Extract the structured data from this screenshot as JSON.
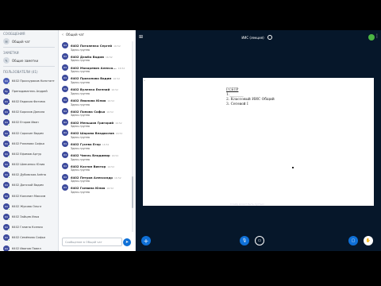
{
  "sidebar": {
    "messages_title": "СООБЩЕНИЯ",
    "public_chat_label": "Общий чат",
    "notes_title": "ЗАМЕТКИ",
    "shared_notes_label": "Общие заметки",
    "users_title": "ПОЛЬЗОВАТЕЛИ (41)",
    "users": [
      {
        "initials": "64",
        "name": "6402 Проскуряков Константин (Вы)"
      },
      {
        "initials": "Пр",
        "name": "Преподаватель Андрей"
      },
      {
        "initials": "64",
        "name": "6402 Евдокия Фатима"
      },
      {
        "initials": "64",
        "name": "6402 Борисов Данила"
      },
      {
        "initials": "64",
        "name": "6402 Егоров Иван"
      },
      {
        "initials": "64",
        "name": "6402 Сорокин Вадим"
      },
      {
        "initials": "64",
        "name": "6402 Рязанова Софья"
      },
      {
        "initials": "64",
        "name": "6402 Ефимов Артур"
      },
      {
        "initials": "64",
        "name": "6402 Шевченко Юлия"
      },
      {
        "initials": "64",
        "name": "6402 Дубовская Алёна"
      },
      {
        "initials": "64",
        "name": "6402 Донской Вадим"
      },
      {
        "initials": "64",
        "name": "6402 Калинин Максим"
      },
      {
        "initials": "64",
        "name": "6402 Жукова Ольга"
      },
      {
        "initials": "64",
        "name": "6402 Зайцев Илья"
      },
      {
        "initials": "64",
        "name": "6402 Ганина Ксения"
      },
      {
        "initials": "64",
        "name": "6402 Семёнова Софья"
      },
      {
        "initials": "64",
        "name": "6402 Иванов Павел"
      }
    ]
  },
  "chat": {
    "title": "Общий чат",
    "messages": [
      {
        "initials": "64",
        "name": "6402 Потапенко Сергей",
        "time": "16:52",
        "text": "Здесь группа"
      },
      {
        "initials": "64",
        "name": "6402 Дзюба Вадим",
        "time": "16:52",
        "text": "Здесь группа"
      },
      {
        "initials": "64",
        "name": "6402 Макаревич Алекса...",
        "time": "16:52",
        "text": "Здесь группа"
      },
      {
        "initials": "64",
        "name": "6402 Прокопова Вадим",
        "time": "16:52",
        "text": "Здесь группа"
      },
      {
        "initials": "64",
        "name": "6402 Вуленко Евгений",
        "time": "16:52",
        "text": "Здесь группа"
      },
      {
        "initials": "64",
        "name": "6402 Яманова Юлия",
        "time": "16:52",
        "text": "Здесь группа"
      },
      {
        "initials": "64",
        "name": "6402 Попова Софья",
        "time": "16:52",
        "text": "Здесь группа"
      },
      {
        "initials": "64",
        "name": "6402 Меньшов Григорий",
        "time": "16:52",
        "text": "Здесь группа"
      },
      {
        "initials": "64",
        "name": "6402 Шарова Владислав",
        "time": "16:52",
        "text": "Здесь группа"
      },
      {
        "initials": "64",
        "name": "6402 Гусева Егор",
        "time": "16:52",
        "text": "Здесь группа"
      },
      {
        "initials": "64",
        "name": "6402 Чмель Владимир",
        "time": "16:52",
        "text": "Здесь группа"
      },
      {
        "initials": "64",
        "name": "6402 Костин Виктор",
        "time": "16:52",
        "text": "Здесь группа"
      },
      {
        "initials": "64",
        "name": "6402 Петров Александр",
        "time": "16:52",
        "text": "Здесь группа"
      },
      {
        "initials": "64",
        "name": "6402 Гаевина Юлия",
        "time": "16:52",
        "text": "Здесь группа"
      }
    ],
    "composer_placeholder": "Сообщение в Общий чат"
  },
  "presentation": {
    "title": "ИИС (лекция)",
    "slide_lines": [
      "ГСБТР",
      "1.________",
      "2. Классовый ИИС Общий",
      "3. Сетевой I"
    ],
    "watermark": "Слайд может быть пустым"
  },
  "icons": {
    "messages": "chat-icon",
    "notes": "note-icon",
    "record": "record-icon",
    "plus": "plus-icon",
    "mic": "mic-icon",
    "camera": "camera-icon",
    "screen": "screen-share-icon",
    "hand": "hand-icon",
    "send": "send-icon"
  },
  "colors": {
    "accent": "#0f70d7",
    "presence": "#4bb543",
    "stage_bg": "#06172a"
  }
}
